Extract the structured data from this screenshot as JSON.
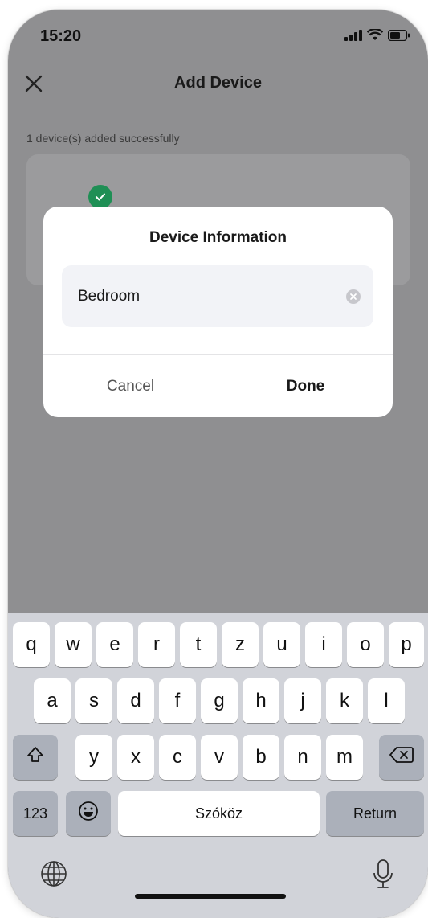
{
  "status_bar": {
    "time": "15:20"
  },
  "header": {
    "title": "Add Device"
  },
  "subtitle": "1 device(s) added successfully",
  "dialog": {
    "title": "Device Information",
    "input_value": "Bedroom",
    "cancel_label": "Cancel",
    "done_label": "Done"
  },
  "keyboard": {
    "row1": [
      "q",
      "w",
      "e",
      "r",
      "t",
      "z",
      "u",
      "i",
      "o",
      "p"
    ],
    "row2": [
      "a",
      "s",
      "d",
      "f",
      "g",
      "h",
      "j",
      "k",
      "l"
    ],
    "row3": [
      "y",
      "x",
      "c",
      "v",
      "b",
      "n",
      "m"
    ],
    "numbers_label": "123",
    "space_label": "Szóköz",
    "return_label": "Return"
  },
  "colors": {
    "overlay_background": "#8f8f91",
    "dialog_background": "#ffffff",
    "success_green": "#1f8f55",
    "keyboard_background": "#d1d3d9"
  }
}
